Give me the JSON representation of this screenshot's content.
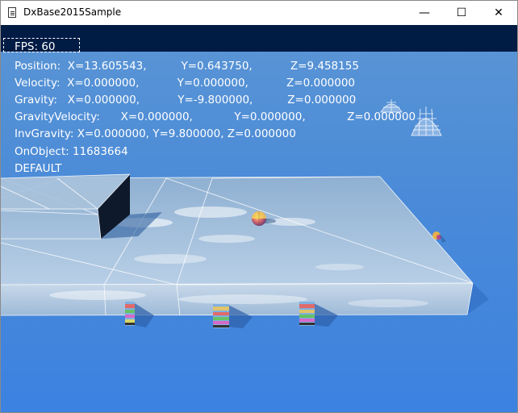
{
  "window": {
    "title": "DxBase2015Sample",
    "minimize_glyph": "—",
    "maximize_glyph": "☐",
    "close_glyph": "✕",
    "icon": "document-icon"
  },
  "hud": {
    "fps": "FPS: 60",
    "position": "Position:  X=13.605543,          Y=0.643750,           Z=9.458155",
    "velocity": "Velocity:  X=0.000000,           Y=0.000000,           Z=0.000000",
    "gravity": "Gravity:   X=0.000000,           Y=-9.800000,          Z=0.000000",
    "gravity_velocity": "GravityVelocity:      X=0.000000,            Y=0.000000,            Z=0.000000",
    "inv_gravity": "InvGravity: X=0.000000, Y=9.800000, Z=0.000000",
    "on_object": "OnObject: 11683664",
    "mode": "DEFAULT"
  },
  "colors": {
    "hud_top_bar": "#001b44",
    "sky_top": "#4f8fd6",
    "sky_bottom": "#3e83df",
    "platform": "#a9c3dd"
  }
}
